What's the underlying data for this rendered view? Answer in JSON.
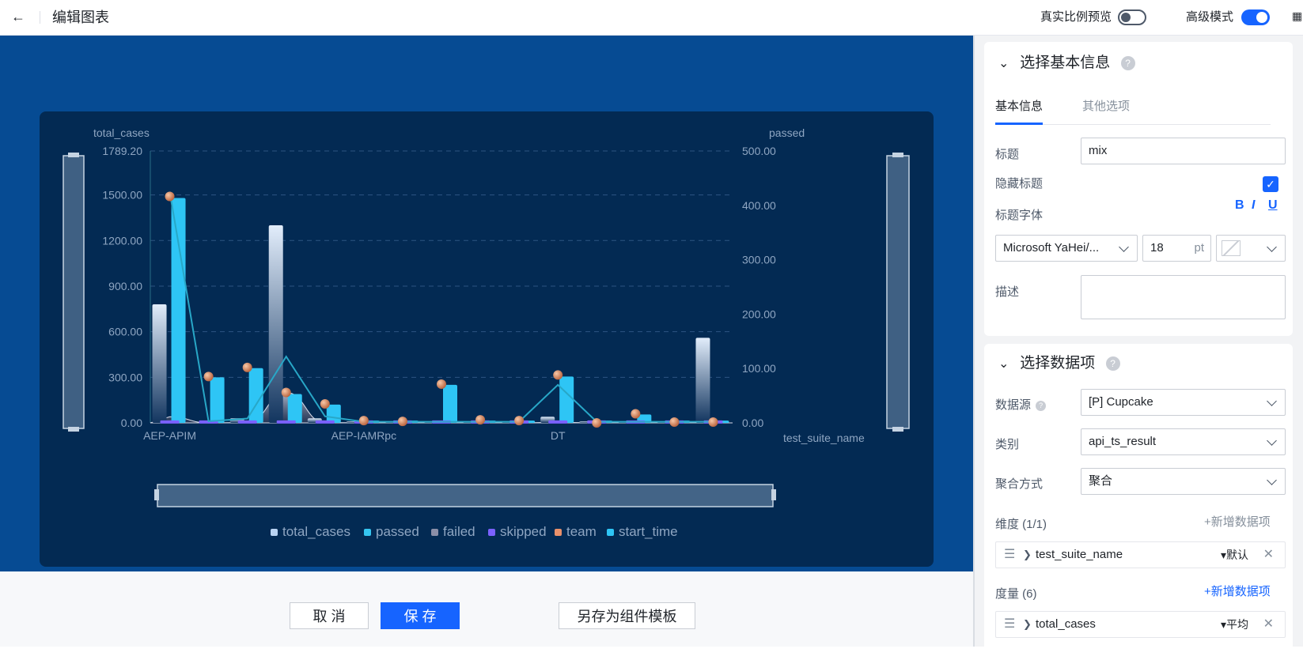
{
  "header": {
    "title": "编辑图表",
    "real_ratio_label": "真实比例预览",
    "real_ratio_on": false,
    "advanced_label": "高级模式",
    "advanced_on": true
  },
  "footer": {
    "cancel": "取 消",
    "save": "保 存",
    "save_template": "另存为组件模板"
  },
  "panel": {
    "basic": {
      "title": "选择基本信息",
      "help": "?",
      "tabs": [
        "基本信息",
        "其他选项"
      ],
      "title_label": "标题",
      "title_value": "mix",
      "hide_title_label": "隐藏标题",
      "hide_title_checked": true,
      "title_font_label": "标题字体",
      "bold": "B",
      "italic": "I",
      "underline": "U",
      "font_family": "Microsoft YaHei/...",
      "font_size": "18",
      "font_unit": "pt",
      "desc_label": "描述"
    },
    "data": {
      "title": "选择数据项",
      "help": "?",
      "source_label": "数据源",
      "source_value": "[P] Cupcake",
      "category_label": "类别",
      "category_value": "api_ts_result",
      "agg_label": "聚合方式",
      "agg_value": "聚合",
      "dim_label": "维度 (1/1)",
      "dim_add": "+新增数据项",
      "dim_item": "test_suite_name",
      "dim_item_agg": "▾默认",
      "measure_label": "度量 (6)",
      "measure_add": "+新增数据项",
      "measure_item": "total_cases",
      "measure_item_agg": "▾平均"
    }
  },
  "chart_data": {
    "type": "bar",
    "left_axis_label": "total_cases",
    "right_axis_label": "passed",
    "x_axis_name": "test_suite_name",
    "left_ticks": [
      "1789.20",
      "1500.00",
      "1200.00",
      "900.00",
      "600.00",
      "300.00",
      "0.00"
    ],
    "right_ticks": [
      "500.00",
      "400.00",
      "300.00",
      "200.00",
      "100.00",
      "0.00"
    ],
    "left_ylim": [
      0,
      1789.2
    ],
    "right_ylim": [
      0,
      500
    ],
    "x_labels": [
      "AEP-APIM",
      "AEP-IAMRpc",
      "DT"
    ],
    "x_label_positions": [
      0,
      5,
      10
    ],
    "x_count": 15,
    "legend": [
      {
        "name": "total_cases",
        "color": "#b9d3f2"
      },
      {
        "name": "passed",
        "color": "#35c5f0"
      },
      {
        "name": "failed",
        "color": "#8b8fa8"
      },
      {
        "name": "skipped",
        "color": "#7b61ff"
      },
      {
        "name": "team",
        "color": "#e9906a"
      },
      {
        "name": "start_time",
        "color": "#2ec5f5"
      }
    ],
    "series": [
      {
        "name": "total_cases",
        "values": [
          780,
          0,
          30,
          1300,
          30,
          10,
          10,
          10,
          10,
          10,
          40,
          10,
          10,
          10,
          560
        ]
      },
      {
        "name": "start_time",
        "values": [
          1480,
          300,
          360,
          190,
          120,
          15,
          15,
          250,
          15,
          15,
          305,
          15,
          55,
          15,
          15
        ]
      },
      {
        "name": "team",
        "values": [
          1490,
          305,
          365,
          200,
          125,
          15,
          10,
          255,
          20,
          15,
          315,
          0,
          60,
          5,
          5
        ]
      },
      {
        "name": "passed",
        "values": [
          425,
          3,
          8,
          122,
          12,
          2,
          2,
          2,
          2,
          2,
          70,
          2,
          2,
          2,
          2
        ]
      },
      {
        "name": "failed",
        "values": [
          40,
          0,
          2,
          200,
          2,
          0,
          0,
          0,
          0,
          0,
          4,
          0,
          0,
          0,
          0
        ]
      },
      {
        "name": "skipped",
        "values": [
          1,
          1,
          1,
          1,
          1,
          1,
          1,
          1,
          1,
          1,
          1,
          1,
          1,
          1,
          1
        ]
      }
    ]
  }
}
